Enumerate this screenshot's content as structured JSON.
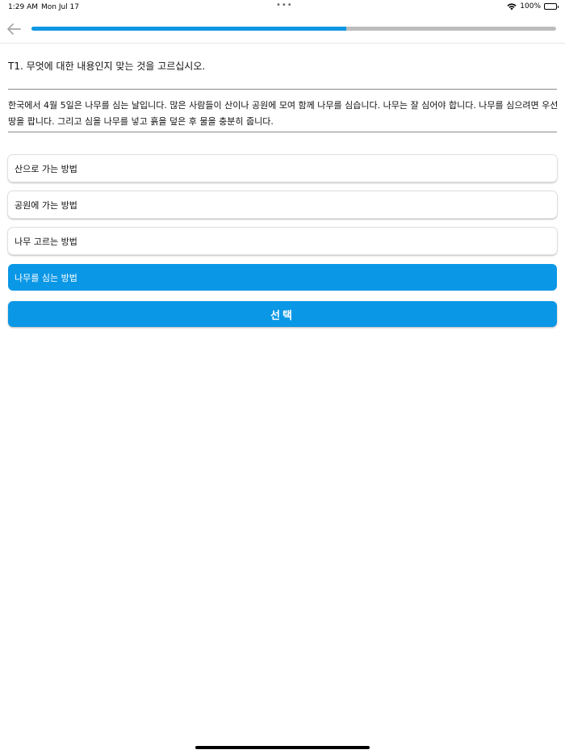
{
  "status_bar": {
    "time": "1:29 AM",
    "date": "Mon Jul 17",
    "battery": "100%"
  },
  "progress": {
    "fraction": 0.6
  },
  "question": {
    "prompt": "T1. 무엇에 대한 내용인지 맞는 것을 고르십시오.",
    "passage": "한국에서 4월 5일은 나무를 심는 날입니다. 많은 사람들이 산이나 공원에 모여 함께 나무를 심습니다. 나무는 잘 심어야 합니다. 나무를 심으려면 우선 땅을 팝니다. 그리고 심을 나무를 넣고 흙을 덮은 후 물을 충분히 줍니다."
  },
  "options": [
    {
      "label": "산으로 가는 방법",
      "selected": false
    },
    {
      "label": "공원에 가는 방법",
      "selected": false
    },
    {
      "label": "나무 고르는 방법",
      "selected": false
    },
    {
      "label": "나무를 심는 방법",
      "selected": true
    }
  ],
  "submit_label": "선택",
  "colors": {
    "accent": "#0a97e6",
    "track": "#bdbdbd"
  }
}
